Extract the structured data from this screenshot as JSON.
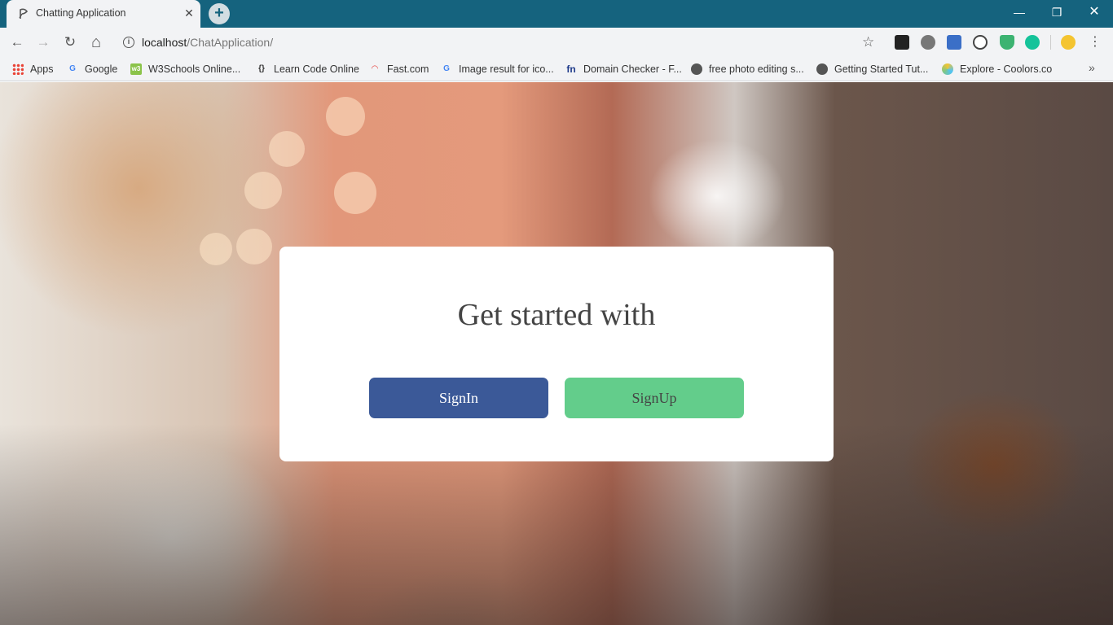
{
  "browser": {
    "tab": {
      "title": "Chatting Application",
      "close_glyph": "✕"
    },
    "new_tab_glyph": "+",
    "window_controls": {
      "minimize": "—",
      "restore": "❐",
      "close": "✕"
    },
    "nav": {
      "back": "←",
      "forward": "→",
      "reload": "↻",
      "home": "⌂"
    },
    "url": {
      "host": "localhost",
      "path": "/ChatApplication/"
    },
    "star_glyph": "☆",
    "menu_glyph": "⋮",
    "extensions": [
      {
        "name": "cb-extension-icon",
        "color": "#222222"
      },
      {
        "name": "settings-extension-icon",
        "color": "#666666"
      },
      {
        "name": "download-extension-icon",
        "color": "#3b6fc7"
      },
      {
        "name": "circle-extension-icon",
        "color": "#444444"
      },
      {
        "name": "shield-extension-icon",
        "color": "#3cb371"
      },
      {
        "name": "grammarly-extension-icon",
        "color": "#15c39a"
      },
      {
        "name": "emoji-extension-icon",
        "color": "#f4c430"
      }
    ],
    "bookmarks": [
      {
        "label": "Apps",
        "icon": "apps-grid-icon"
      },
      {
        "label": "Google",
        "icon": "google-icon"
      },
      {
        "label": "W3Schools Online...",
        "icon": "w3schools-icon"
      },
      {
        "label": "Learn Code Online",
        "icon": "code-icon"
      },
      {
        "label": "Fast.com",
        "icon": "speed-icon"
      },
      {
        "label": "Image result for ico...",
        "icon": "google-icon"
      },
      {
        "label": "Domain Checker - F...",
        "icon": "fn-icon"
      },
      {
        "label": "free photo editing s...",
        "icon": "globe-icon"
      },
      {
        "label": "Getting Started Tut...",
        "icon": "globe-icon"
      },
      {
        "label": "Explore - Coolors.co",
        "icon": "coolors-icon"
      }
    ],
    "bookmarks_more_glyph": "»"
  },
  "page": {
    "heading": "Get started with",
    "signin_label": "SignIn",
    "signup_label": "SignUp"
  },
  "colors": {
    "titlebar": "#15637e",
    "signin": "#3b5998",
    "signup": "#63cd8b"
  }
}
